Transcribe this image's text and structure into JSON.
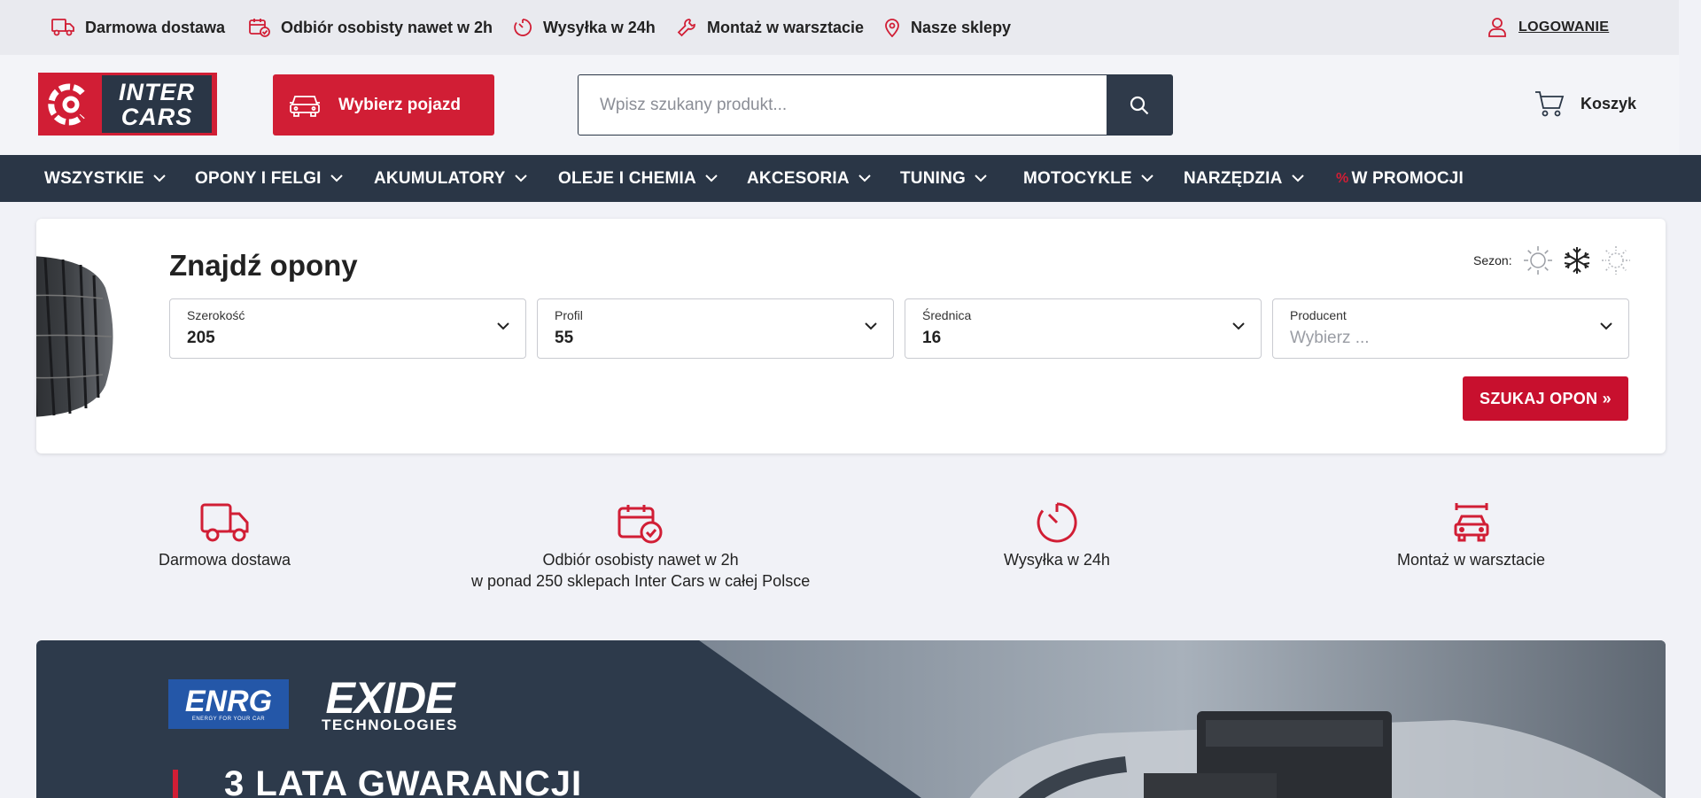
{
  "topbar": {
    "items": [
      {
        "label": "Darmowa dostawa",
        "icon": "truck-icon"
      },
      {
        "label": "Odbiór osobisty nawet w 2h",
        "icon": "calendar-check-icon"
      },
      {
        "label": "Wysyłka w 24h",
        "icon": "timer-icon"
      },
      {
        "label": "Montaż w warsztacie",
        "icon": "wrench-icon"
      },
      {
        "label": "Nasze sklepy",
        "icon": "map-pin-icon"
      }
    ],
    "login_label": "LOGOWANIE"
  },
  "header": {
    "logo_line1": "INTER",
    "logo_line2": "CARS",
    "vehicle_button": "Wybierz pojazd",
    "search_placeholder": "Wpisz szukany produkt...",
    "cart_label": "Koszyk"
  },
  "nav": {
    "items": [
      {
        "label": "WSZYSTKIE"
      },
      {
        "label": "OPONY I FELGI"
      },
      {
        "label": "AKUMULATORY"
      },
      {
        "label": "OLEJE I CHEMIA"
      },
      {
        "label": "AKCESORIA"
      },
      {
        "label": "TUNING"
      },
      {
        "label": "MOTOCYKLE"
      },
      {
        "label": "NARZĘDZIA"
      },
      {
        "label": "W PROMOCJI"
      }
    ],
    "promo_glyph": "%"
  },
  "finder": {
    "title": "Znajdź opony",
    "season_label": "Sezon:",
    "season_icons": [
      "sun-icon",
      "snowflake-icon",
      "all-season-icon"
    ],
    "fields": [
      {
        "label": "Szerokość",
        "value": "205"
      },
      {
        "label": "Profil",
        "value": "55"
      },
      {
        "label": "Średnica",
        "value": "16"
      },
      {
        "label": "Producent",
        "placeholder": "Wybierz ..."
      }
    ],
    "search_button": "SZUKAJ OPON »"
  },
  "benefits": [
    {
      "line1": "Darmowa dostawa",
      "line2": ""
    },
    {
      "line1": "Odbiór osobisty nawet w 2h",
      "line2": "w ponad 250 sklepach Inter Cars w całej Polsce"
    },
    {
      "line1": "Wysyłka w 24h",
      "line2": ""
    },
    {
      "line1": "Montaż w warsztacie",
      "line2": ""
    }
  ],
  "banner": {
    "brand1": "ENRG",
    "brand1_tagline": "ENERGY FOR YOUR CAR",
    "brand2": "EXIDE",
    "brand2_sub": "TECHNOLOGIES",
    "headline": "3 LATA GWARANCJI"
  },
  "colors": {
    "brand_red": "#d11e35",
    "navy": "#2a3646"
  }
}
